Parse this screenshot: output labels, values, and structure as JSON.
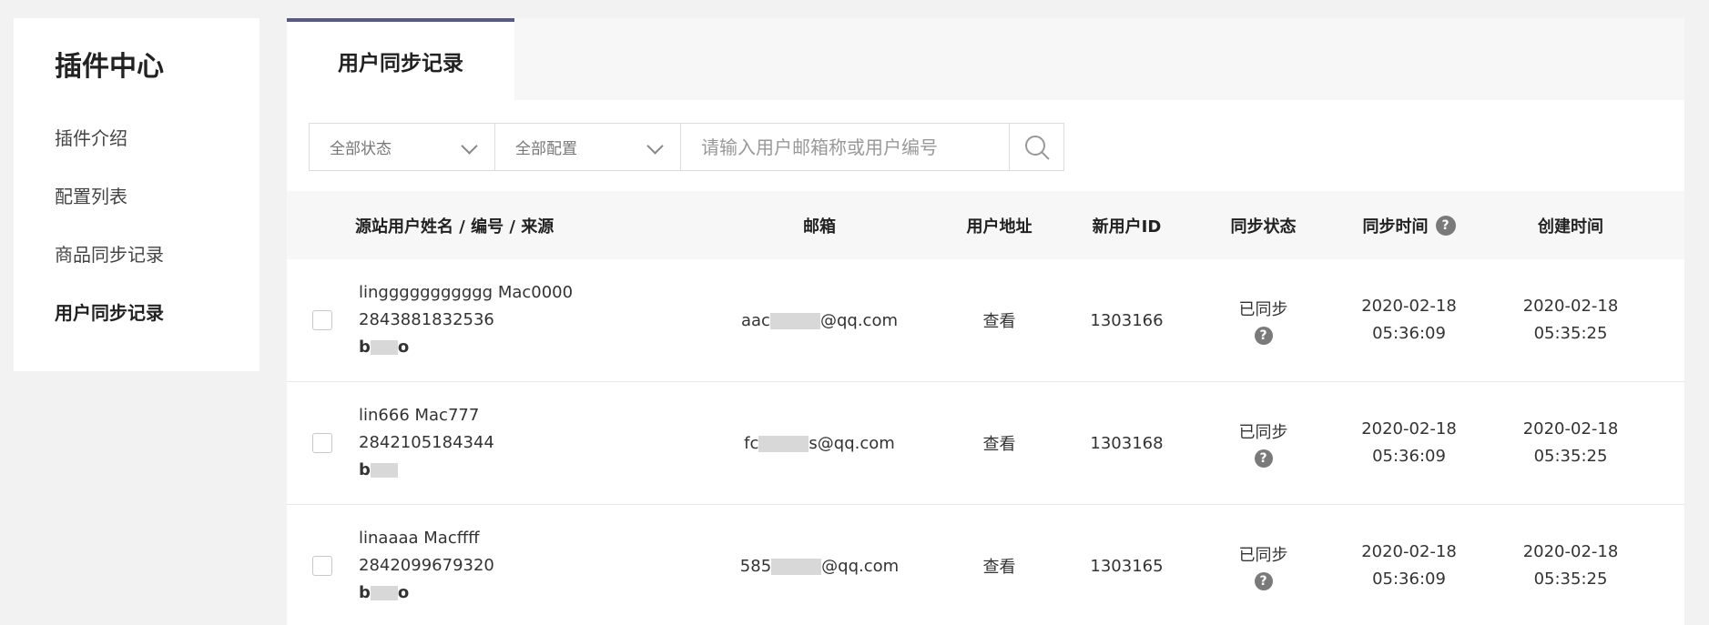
{
  "sidebar": {
    "title": "插件中心",
    "items": [
      {
        "label": "插件介绍"
      },
      {
        "label": "配置列表"
      },
      {
        "label": "商品同步记录"
      },
      {
        "label": "用户同步记录"
      }
    ]
  },
  "tabs": [
    {
      "label": "用户同步记录"
    }
  ],
  "filters": {
    "status": "全部状态",
    "config": "全部配置",
    "search_placeholder": "请输入用户邮箱称或用户编号"
  },
  "table": {
    "headers": {
      "name": "源站用户姓名 / 编号 / 来源",
      "email": "邮箱",
      "address": "用户地址",
      "new_id": "新用户ID",
      "sync_status": "同步状态",
      "sync_time": "同步时间",
      "created": "创建时间"
    },
    "rows": [
      {
        "name": "linggggggggggg  Mac0000",
        "number": "2843881832536",
        "source": "b",
        "source_tail": "o",
        "email_prefix": "aac",
        "email_suffix": "@qq.com",
        "address": "查看",
        "new_id": "1303166",
        "status": "已同步",
        "sync_date": "2020-02-18",
        "sync_clock": "05:36:09",
        "created_date": "2020-02-18",
        "created_clock": "05:35:25"
      },
      {
        "name": "lin666  Mac777",
        "number": "2842105184344",
        "source": "b",
        "source_tail": "",
        "email_prefix": "fc",
        "email_suffix": "s@qq.com",
        "address": "查看",
        "new_id": "1303168",
        "status": "已同步",
        "sync_date": "2020-02-18",
        "sync_clock": "05:36:09",
        "created_date": "2020-02-18",
        "created_clock": "05:35:25"
      },
      {
        "name": "linaaaa  Macffff",
        "number": "2842099679320",
        "source": "b",
        "source_tail": "o",
        "email_prefix": "585",
        "email_suffix": "@qq.com",
        "address": "查看",
        "new_id": "1303165",
        "status": "已同步",
        "sync_date": "2020-02-18",
        "sync_clock": "05:36:09",
        "created_date": "2020-02-18",
        "created_clock": "05:35:25"
      }
    ]
  },
  "icons": {
    "help": "?",
    "accent_color": "#5a5a7e"
  }
}
